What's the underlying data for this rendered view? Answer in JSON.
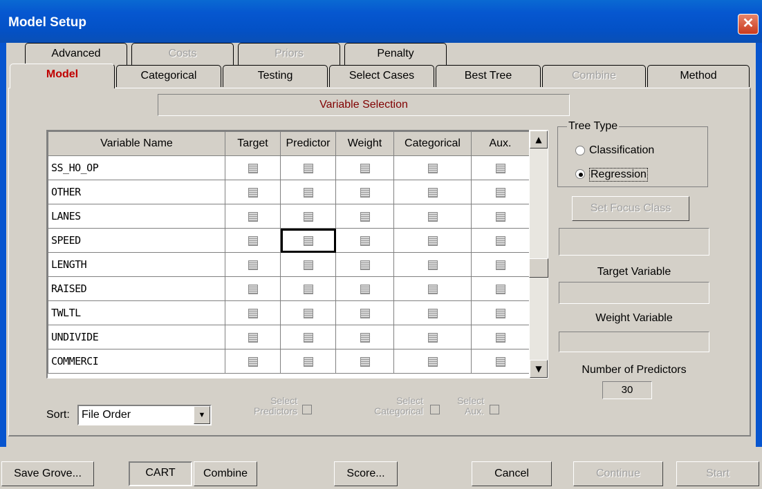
{
  "window": {
    "title": "Model Setup",
    "close_glyph": "✕"
  },
  "tabs_row1": [
    {
      "label": "Advanced",
      "enabled": true
    },
    {
      "label": "Costs",
      "enabled": false
    },
    {
      "label": "Priors",
      "enabled": false
    },
    {
      "label": "Penalty",
      "enabled": true
    }
  ],
  "tabs_row2": [
    {
      "label": "Model",
      "enabled": true,
      "active": true
    },
    {
      "label": "Categorical",
      "enabled": true
    },
    {
      "label": "Testing",
      "enabled": true
    },
    {
      "label": "Select Cases",
      "enabled": true
    },
    {
      "label": "Best Tree",
      "enabled": true
    },
    {
      "label": "Combine",
      "enabled": false
    },
    {
      "label": "Method",
      "enabled": true
    }
  ],
  "variable_selection_label": "Variable Selection",
  "table": {
    "headers": [
      "Variable Name",
      "Target",
      "Predictor",
      "Weight",
      "Categorical",
      "Aux."
    ],
    "rows": [
      "SS_HO_OP",
      "OTHER",
      "LANES",
      "SPEED",
      "LENGTH",
      "RAISED",
      "TWLTL",
      "UNDIVIDE",
      "COMMERCI"
    ],
    "focused_cell": {
      "row": "SPEED",
      "column": "Predictor"
    }
  },
  "tree_type": {
    "title": "Tree Type",
    "options": [
      "Classification",
      "Regression"
    ],
    "selected": "Regression"
  },
  "set_focus_class_label": "Set Focus Class",
  "target_variable_label": "Target Variable",
  "weight_variable_label": "Weight Variable",
  "num_predictors_label": "Number of Predictors",
  "num_predictors_value": "30",
  "sort": {
    "label": "Sort:",
    "value": "File Order"
  },
  "select_predictors": {
    "line1": "Select",
    "line2": "Predictors"
  },
  "select_categorical": {
    "line1": "Select",
    "line2": "Categorical"
  },
  "select_aux": {
    "line1": "Select",
    "line2": "Aux."
  },
  "bottom_buttons": {
    "save_grove": "Save Grove...",
    "cart": "CART",
    "combine": "Combine",
    "score": "Score...",
    "cancel": "Cancel",
    "continue": "Continue",
    "start": "Start"
  }
}
